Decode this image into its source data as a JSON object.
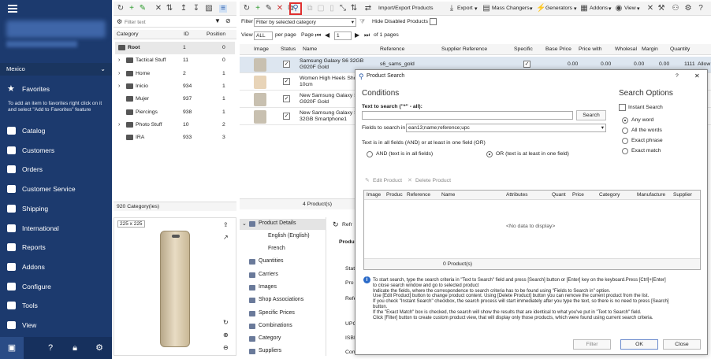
{
  "nav": {
    "country": "Mexico",
    "favorites_label": "Favorites",
    "favorites_hint": "To add an item to favorites right click on it and select \"Add to Favorites\" feature",
    "items": [
      {
        "label": "Catalog",
        "icon": "catalog-icon"
      },
      {
        "label": "Customers",
        "icon": "customers-icon"
      },
      {
        "label": "Orders",
        "icon": "orders-icon"
      },
      {
        "label": "Customer Service",
        "icon": "customer-service-icon"
      },
      {
        "label": "Shipping",
        "icon": "shipping-icon"
      },
      {
        "label": "International",
        "icon": "globe-icon"
      },
      {
        "label": "Reports",
        "icon": "reports-icon"
      },
      {
        "label": "Addons",
        "icon": "addons-icon"
      },
      {
        "label": "Configure",
        "icon": "configure-icon"
      },
      {
        "label": "Tools",
        "icon": "tools-icon"
      },
      {
        "label": "View",
        "icon": "view-icon"
      }
    ]
  },
  "categories": {
    "filter_placeholder": "Filter text",
    "col_category": "Category",
    "col_id": "ID",
    "col_position": "Position",
    "rows": [
      {
        "name": "Root",
        "id": "1",
        "pos": "0"
      },
      {
        "name": "Tactical Stuff",
        "id": "11",
        "pos": "0"
      },
      {
        "name": "Home",
        "id": "2",
        "pos": "1"
      },
      {
        "name": "Inicio",
        "id": "934",
        "pos": "1"
      },
      {
        "name": "Mujer",
        "id": "937",
        "pos": "1"
      },
      {
        "name": "Piercings",
        "id": "938",
        "pos": "1"
      },
      {
        "name": "Photo Stuff",
        "id": "10",
        "pos": "2"
      },
      {
        "name": "IRA",
        "id": "933",
        "pos": "3"
      }
    ],
    "footer": "920 Category(ies)"
  },
  "image_panel": {
    "size": "225 x 225"
  },
  "products": {
    "filter_label": "Filter",
    "filter_value": "Filter by selected category",
    "hide_disabled": "Hide Disabled Products",
    "view_label": "View",
    "view_value": "ALL",
    "per_page": "per page",
    "page_label": "Page",
    "page_value": "1",
    "of_pages": "of 1 pages",
    "toolbar": {
      "import_export": "Import/Export Products",
      "export": "Export",
      "mass_changers": "Mass Changers",
      "generators": "Generators",
      "addons": "Addons",
      "view": "View"
    },
    "columns": [
      "Image",
      "Status",
      "Name",
      "Reference",
      "Supplier Reference",
      "Specific",
      "Base Price",
      "Price with",
      "Wholesal",
      "Margin",
      "Quantity",
      "Allow"
    ],
    "rows": [
      {
        "name": "Samsung Galaxy S6 32GB G920F Gold",
        "ref": "s6_sams_gold",
        "base": "0.00",
        "pwith": "0.00",
        "whole": "0.00",
        "margin": "0.00",
        "qty": "1111",
        "allow": "Allow"
      },
      {
        "name": "Women High Heels Shoes 10cm",
        "ref": ""
      },
      {
        "name": "New Samsung Galaxy S5 G920F Gold",
        "ref": ""
      },
      {
        "name": "New Samsung Galaxy S5 SM 32GB Smartphone1",
        "ref": ""
      }
    ],
    "footer": "4 Product(s)"
  },
  "details": {
    "items": [
      "Product Details",
      "English (English)",
      "French",
      "Quantities",
      "Carriers",
      "Images",
      "Shop Associations",
      "Specific Prices",
      "Combinations",
      "Category",
      "Suppliers"
    ],
    "refresh": "Refr",
    "right_labels": [
      "Produ",
      "Stat",
      "Pro",
      "Refe",
      "UPC",
      "ISBN",
      "Con"
    ]
  },
  "dialog": {
    "title": "Product Search",
    "help": "?",
    "close": "✕",
    "conditions": "Conditions",
    "search_options": "Search Options",
    "text_to_search_label": "Text to search (\"*\" - all):",
    "text_to_search_value": "",
    "search_button": "Search",
    "fields_label": "Fields to search in",
    "fields_value": "ean13;name;reference;upc",
    "text_in_all": "Text is in all fields (AND) or at least in one field (OR)",
    "and_option": "AND (text is in all fields)",
    "or_option": "OR (text is at least in one field)",
    "instant_search": "Instant Search",
    "any_word": "Any word",
    "all_words": "All the words",
    "exact_phrase": "Exact phrase",
    "exact_match": "Exact match",
    "edit_product": "Edit Product",
    "delete_product": "Delete Product",
    "grid_columns": [
      "Image",
      "Produc",
      "Reference",
      "Name",
      "Attributes",
      "Quant",
      "Price",
      "Category",
      "Manufacture",
      "Supplier"
    ],
    "no_data": "<No data to display>",
    "grid_footer": "0 Product(s)",
    "info": [
      [
        "To start search, type the search criteria in \"Text to Search\" field and press [Search] button or [Enter] key on the keyboard.Press [Ctrl]+[Enter]"
      ],
      [
        "to close search window and go to selected product"
      ],
      [
        "Indicate the fields, where the correspondence to search criteria has to be found using \"Fields to Search in\" option."
      ],
      [
        "Use [Edit Product] button to change product content. Using [Delete Product] button you can remove the current product from the list."
      ],
      [
        "If you check \"Instant Search\" checkbox, the search process will start immediately after you type the text, so there is no need to press [Search]"
      ],
      [
        "button."
      ],
      [
        "If the \"Exact Match\" box is checked, the search will show the results that are identical to what you've put in \"Text to Search\" field."
      ],
      [
        "Click [Filter] button to create custom product view, that will display only those products, which were found using current search criteria."
      ]
    ],
    "filter_button": "Filter",
    "ok_button": "OK",
    "close_button": "Close"
  },
  "colors": {
    "nav": "#1c3a6e",
    "accent": "#2a9a2a",
    "highlight_box": "#e03030"
  }
}
